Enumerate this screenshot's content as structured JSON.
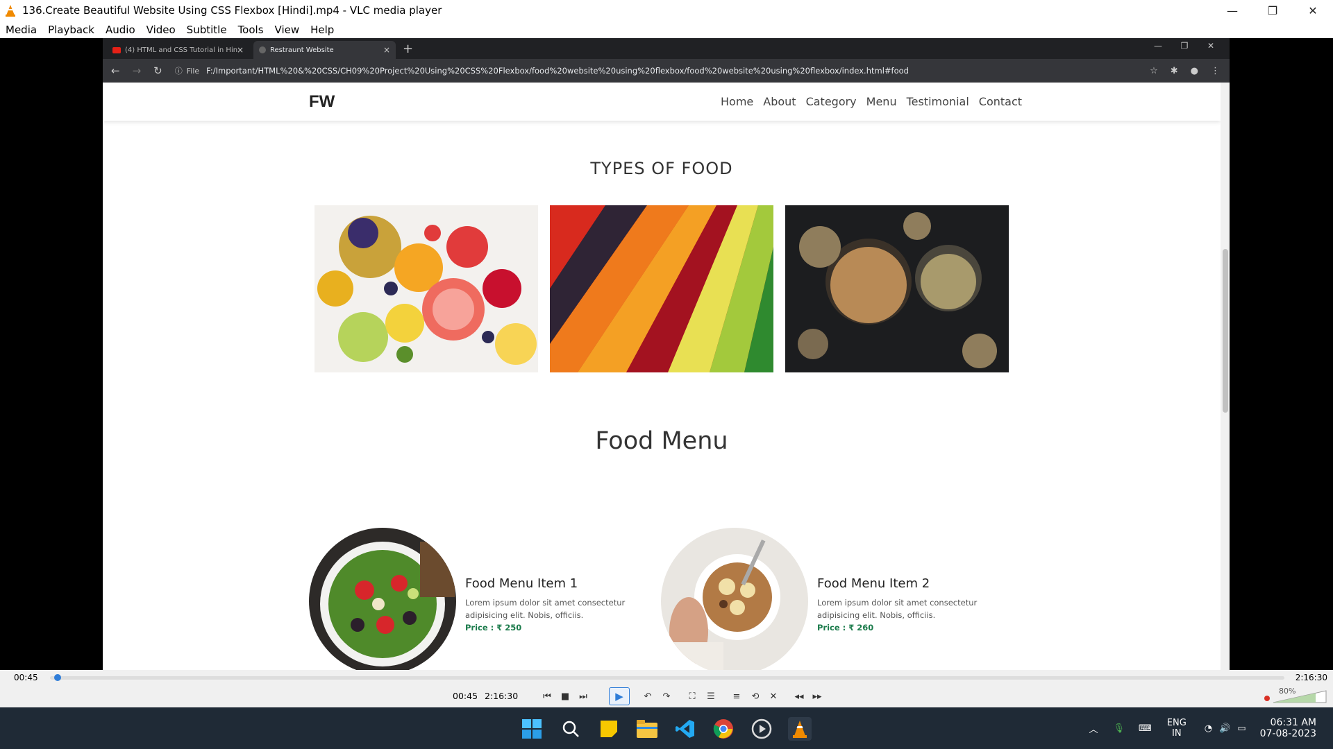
{
  "vlc": {
    "title": "136.Create Beautiful Website Using CSS Flexbox [Hindi].mp4 - VLC media player",
    "menu": [
      "Media",
      "Playback",
      "Audio",
      "Video",
      "Subtitle",
      "Tools",
      "View",
      "Help"
    ]
  },
  "browser": {
    "tabs": [
      {
        "label": "(4) HTML and CSS Tutorial in Hin"
      },
      {
        "label": "Restraunt Website"
      }
    ],
    "address_prefix": "File",
    "url": "F:/Important/HTML%20&%20CSS/CH09%20Project%20Using%20CSS%20Flexbox/food%20website%20using%20flexbox/food%20website%20using%20flexbox/index.html#food"
  },
  "site": {
    "logo": "FW",
    "nav": [
      "Home",
      "About",
      "Category",
      "Menu",
      "Testimonial",
      "Contact"
    ],
    "types_title": "TYPES OF FOOD",
    "menu_title": "Food Menu",
    "items": [
      {
        "name": "Food Menu Item 1",
        "desc": "Lorem ipsum dolor sit amet consectetur adipisicing elit. Nobis, officiis.",
        "price": "Price : ₹ 250"
      },
      {
        "name": "Food Menu Item 2",
        "desc": "Lorem ipsum dolor sit amet consectetur adipisicing elit. Nobis, officiis.",
        "price": "Price : ₹ 260"
      }
    ]
  },
  "player": {
    "elapsed": "00:45",
    "total": "2:16:30",
    "progress_fraction": 0.006,
    "volume": "80%"
  },
  "taskbar": {
    "lang1": "ENG",
    "lang2": "IN",
    "time": "06:31 AM",
    "date": "07-08-2023"
  }
}
